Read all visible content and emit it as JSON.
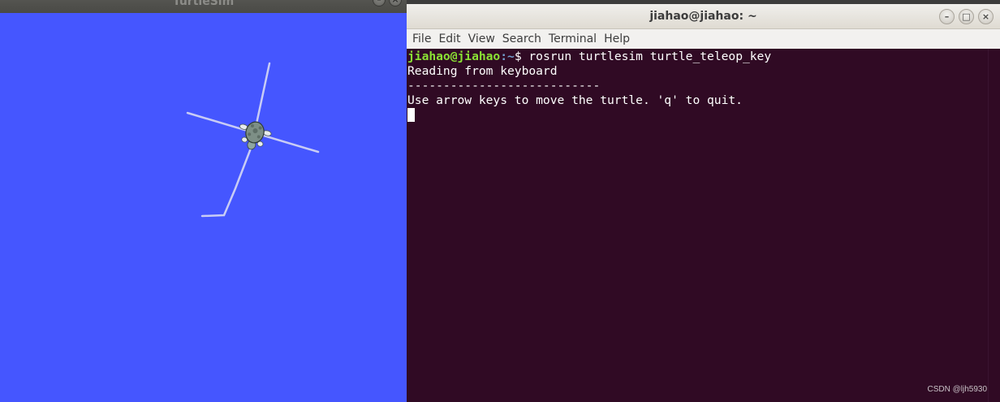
{
  "turtlesim": {
    "title": "TurtleSim",
    "background_color": "#4556ff",
    "trail_color": "#c8ccf5",
    "buttons": {
      "minimize": "–",
      "close": "×"
    }
  },
  "terminal": {
    "title": "jiahao@jiahao: ~",
    "background_color": "#300a24",
    "menu": [
      "File",
      "Edit",
      "View",
      "Search",
      "Terminal",
      "Help"
    ],
    "buttons": {
      "minimize": "–",
      "maximize": "□",
      "close": "×"
    },
    "lines": {
      "prompt_user": "jiahao@jiahao",
      "prompt_path": ":~",
      "prompt_symbol": "$ ",
      "command": "rosrun turtlesim turtle_teleop_key",
      "line2": "Reading from keyboard",
      "line3": "---------------------------",
      "line4": "Use arrow keys to move the turtle. 'q' to quit."
    },
    "watermark": "CSDN @ljh5930"
  }
}
